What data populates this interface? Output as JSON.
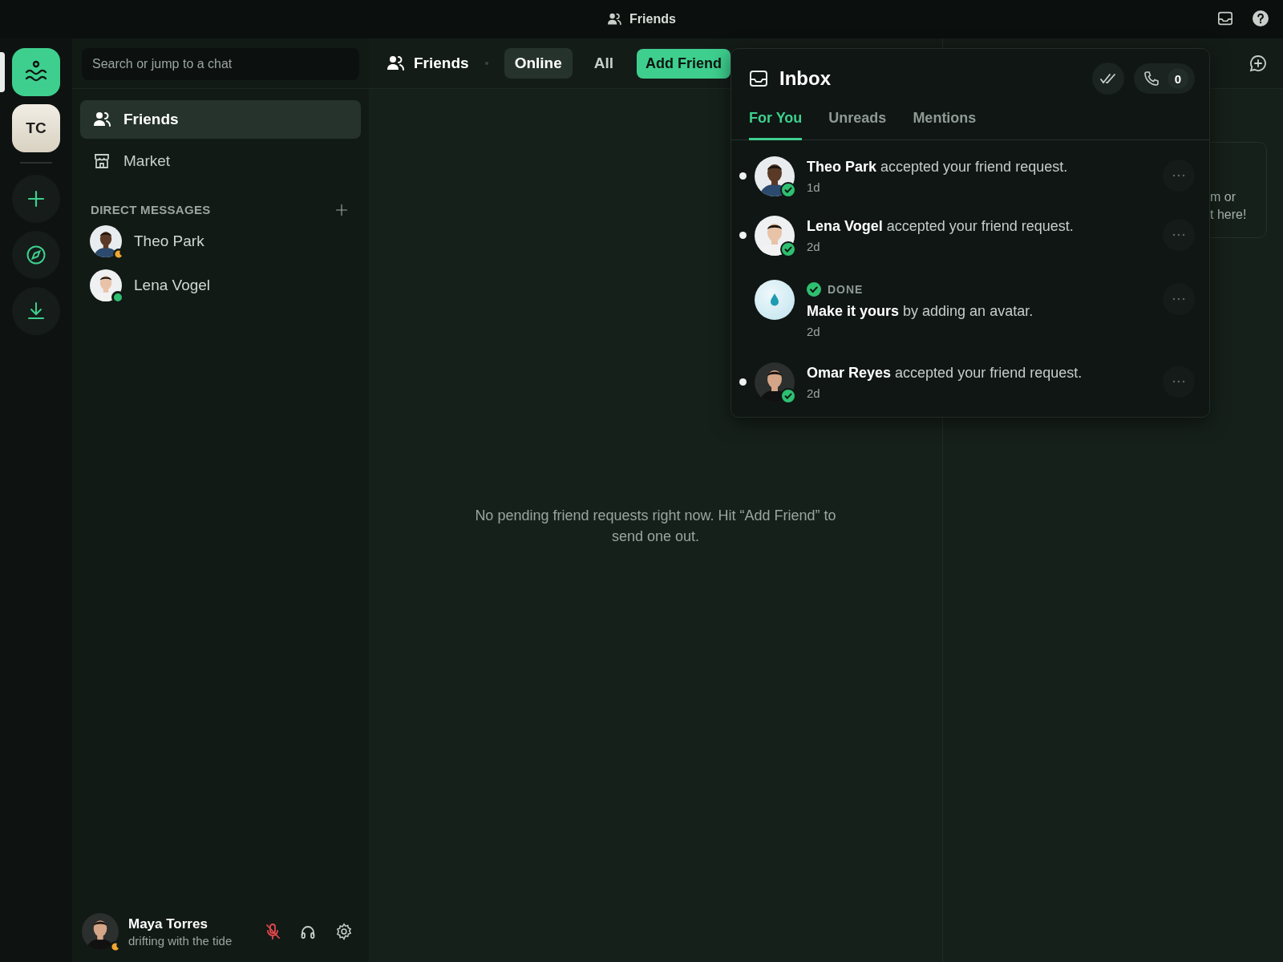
{
  "title_bar": {
    "title": "Friends"
  },
  "servers": [
    {
      "kind": "home",
      "selected": true
    },
    {
      "kind": "initials",
      "label": "TC",
      "selected": false
    },
    {
      "kind": "add"
    },
    {
      "kind": "explore"
    },
    {
      "kind": "download"
    }
  ],
  "sidebar": {
    "search": {
      "placeholder": "Search or jump to a chat"
    },
    "nav": [
      {
        "label": "Friends",
        "selected": true
      },
      {
        "label": "Market",
        "selected": false
      }
    ],
    "dm_heading": "DIRECT MESSAGES",
    "dms": [
      {
        "name": "Theo Park",
        "kind": "idle"
      },
      {
        "name": "Lena Vogel",
        "kind": "online"
      }
    ]
  },
  "user": {
    "name": "Maya Torres",
    "status_text": "drifting with the tide",
    "presence": [
      {
        "kind": "idle"
      }
    ],
    "muted": true
  },
  "header": {
    "title": "Friends",
    "tabs": [
      {
        "label": "Online",
        "selected": true
      },
      {
        "label": "All",
        "selected": false
      }
    ],
    "add_button": "Add Friend"
  },
  "empty_message": "No pending friend requests right now. Hit “Add Friend” to send one out.",
  "side_card": {
    "lines": [
      "m or",
      "t here!"
    ]
  },
  "inbox": {
    "title": "Inbox",
    "call_count": "0",
    "tabs": [
      {
        "label": "For You",
        "selected": true
      },
      {
        "label": "Unreads",
        "selected": false
      },
      {
        "label": "Mentions",
        "selected": false
      }
    ],
    "items": [
      {
        "kind": "friend",
        "text": "**Theo Park** accepted your friend request.",
        "time": "1d",
        "unread": true
      },
      {
        "kind": "friend",
        "text": "**Lena Vogel** accepted your friend request.",
        "time": "2d",
        "unread": true
      },
      {
        "kind": "task",
        "badge": "DONE",
        "text": "**Make it yours** by adding an avatar.",
        "time": "2d",
        "unread": false
      },
      {
        "kind": "friend",
        "text": "**Omar Reyes** accepted your friend request.",
        "time": "2d",
        "unread": true
      }
    ]
  }
}
